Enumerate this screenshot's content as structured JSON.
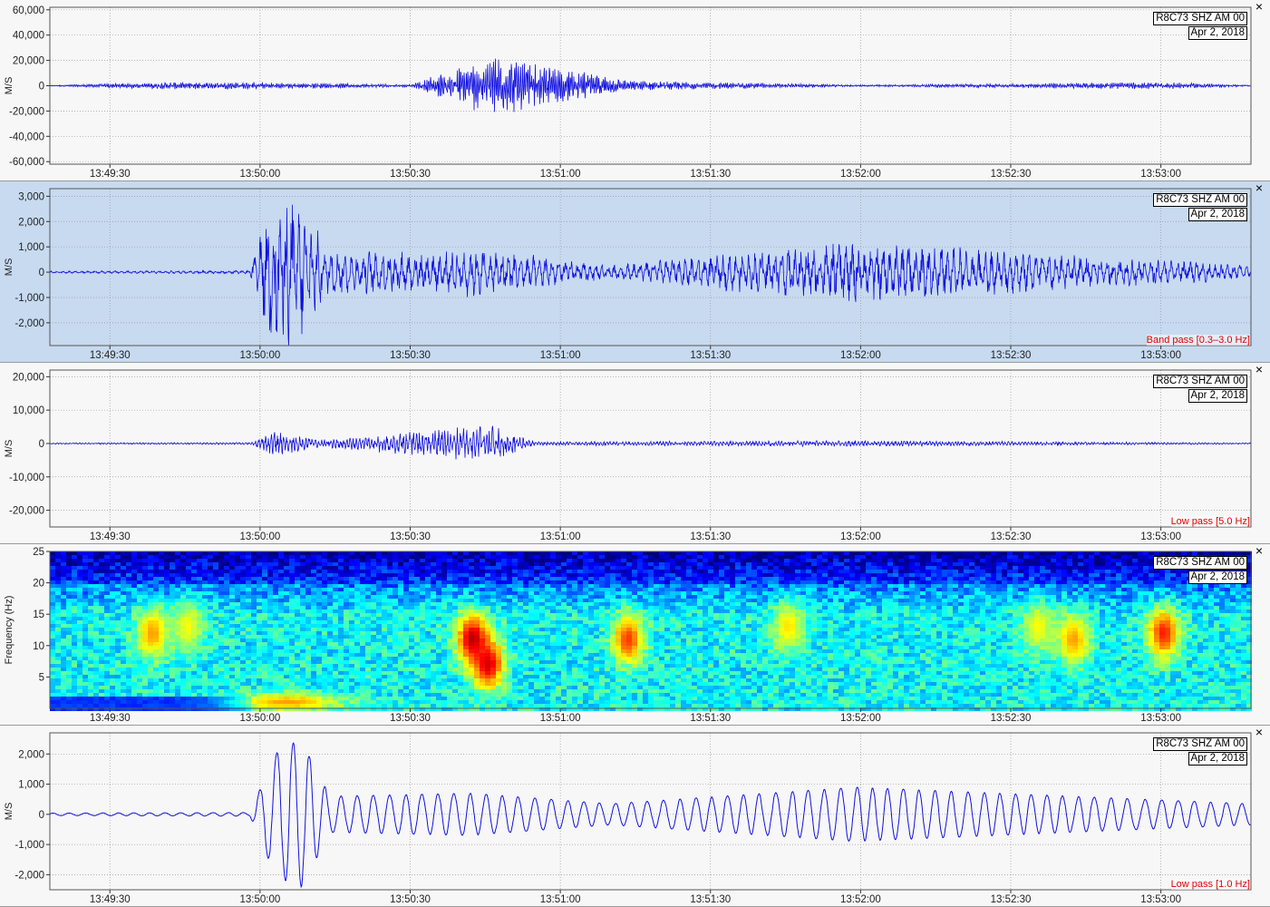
{
  "station_label": "R8C73 SHZ AM 00",
  "date_label": "Apr 2, 2018",
  "close_glyph": "×",
  "time_ticks": [
    "13:49:30",
    "13:50:00",
    "13:50:30",
    "13:51:00",
    "13:51:30",
    "13:52:00",
    "13:52:30",
    "13:53:00"
  ],
  "waveform_color": "#1010e0",
  "filter_color": "#e00000",
  "panels": [
    {
      "ylabel": "M/S",
      "selected": false,
      "filter": "",
      "chart_data": {
        "type": "line",
        "title": "",
        "xlabel": "",
        "ylabel": "M/S",
        "ylim": [
          -62000,
          62000
        ],
        "yticks": [
          60000,
          40000,
          20000,
          0,
          -20000,
          -40000,
          -60000
        ],
        "ytick_labels": [
          "60,000",
          "40,000",
          "20,000",
          "0",
          "-20,000",
          "-40,000",
          "-60,000"
        ],
        "series": [
          {
            "values": [
              {
                "t": "13:49:18",
                "amp": 400
              },
              {
                "t": "13:49:40",
                "amp": 2500
              },
              {
                "t": "13:50:00",
                "amp": 2500
              },
              {
                "t": "13:50:30",
                "amp": 900
              },
              {
                "t": "13:50:42",
                "amp": 17000
              },
              {
                "t": "13:50:47",
                "amp": 21000
              },
              {
                "t": "13:51:14",
                "amp": 3500
              },
              {
                "t": "13:52:00",
                "amp": 600
              },
              {
                "t": "13:53:00",
                "amp": 2500
              },
              {
                "t": "13:53:18",
                "amp": 400
              }
            ]
          }
        ]
      }
    },
    {
      "ylabel": "M/S",
      "selected": true,
      "filter": "Band pass [0.3–3.0 Hz]",
      "chart_data": {
        "type": "line",
        "title": "",
        "xlabel": "",
        "ylabel": "M/S",
        "ylim": [
          -2900,
          3300
        ],
        "yticks": [
          3000,
          2000,
          1000,
          0,
          -1000,
          -2000
        ],
        "ytick_labels": [
          "3,000",
          "2,000",
          "1,000",
          "0",
          "-1,000",
          "-2,000"
        ],
        "series": [
          {
            "values": [
              {
                "t": "13:49:18",
                "amp": 40
              },
              {
                "t": "13:49:58",
                "amp": 60
              },
              {
                "t": "13:50:02",
                "amp": 2600
              },
              {
                "t": "13:50:06",
                "amp": 2900
              },
              {
                "t": "13:50:14",
                "amp": 800
              },
              {
                "t": "13:50:35",
                "amp": 700
              },
              {
                "t": "13:50:42",
                "amp": 900
              },
              {
                "t": "13:51:10",
                "amp": 250
              },
              {
                "t": "13:51:59",
                "amp": 1100
              },
              {
                "t": "13:53:18",
                "amp": 250
              }
            ]
          }
        ]
      }
    },
    {
      "ylabel": "M/S",
      "selected": false,
      "filter": "Low pass [5.0 Hz]",
      "chart_data": {
        "type": "line",
        "title": "",
        "xlabel": "",
        "ylabel": "M/S",
        "ylim": [
          -25000,
          22000
        ],
        "yticks": [
          20000,
          10000,
          0,
          -10000,
          -20000
        ],
        "ytick_labels": [
          "20,000",
          "10,000",
          "0",
          "-10,000",
          "-20,000"
        ],
        "series": [
          {
            "values": [
              {
                "t": "13:49:18",
                "amp": 200
              },
              {
                "t": "13:49:58",
                "amp": 300
              },
              {
                "t": "13:50:03",
                "amp": 3500
              },
              {
                "t": "13:50:12",
                "amp": 1000
              },
              {
                "t": "13:50:42",
                "amp": 4500
              },
              {
                "t": "13:50:47",
                "amp": 5000
              },
              {
                "t": "13:50:55",
                "amp": 500
              },
              {
                "t": "13:52:00",
                "amp": 800
              },
              {
                "t": "13:53:18",
                "amp": 200
              }
            ]
          }
        ]
      }
    },
    {
      "ylabel": "Frequency (Hz)",
      "selected": false,
      "filter": "",
      "chart_data": {
        "type": "heatmap",
        "title": "",
        "xlabel": "",
        "ylabel": "Frequency (Hz)",
        "ylim": [
          0,
          25
        ],
        "yticks": [
          25,
          20,
          15,
          10,
          5
        ],
        "ytick_labels": [
          "25",
          "20",
          "15",
          "10",
          "5"
        ],
        "hot_spots": [
          {
            "t": "13:49:38",
            "f": 12,
            "level": 0.72
          },
          {
            "t": "13:49:45",
            "f": 13,
            "level": 0.62
          },
          {
            "t": "13:50:42",
            "f": 11,
            "level": 0.95
          },
          {
            "t": "13:50:45",
            "f": 7,
            "level": 0.92
          },
          {
            "t": "13:51:13",
            "f": 11,
            "level": 0.82
          },
          {
            "t": "13:51:45",
            "f": 13,
            "level": 0.65
          },
          {
            "t": "13:52:35",
            "f": 13,
            "level": 0.62
          },
          {
            "t": "13:52:42",
            "f": 11,
            "level": 0.72
          },
          {
            "t": "13:53:00",
            "f": 12,
            "level": 0.85
          },
          {
            "t": "13:50:05",
            "f": 1,
            "level": 0.72
          }
        ]
      }
    },
    {
      "ylabel": "M/S",
      "selected": false,
      "filter": "Low pass [1.0 Hz]",
      "chart_data": {
        "type": "line",
        "title": "",
        "xlabel": "",
        "ylabel": "M/S",
        "ylim": [
          -2500,
          2700
        ],
        "yticks": [
          2000,
          1000,
          0,
          -1000,
          -2000
        ],
        "ytick_labels": [
          "2,000",
          "1,000",
          "0",
          "-1,000",
          "-2,000"
        ],
        "series": [
          {
            "values": [
              {
                "t": "13:49:18",
                "amp": 40
              },
              {
                "t": "13:49:58",
                "amp": 60
              },
              {
                "t": "13:50:03",
                "amp": 2000
              },
              {
                "t": "13:50:08",
                "amp": 2500
              },
              {
                "t": "13:50:14",
                "amp": 600
              },
              {
                "t": "13:50:42",
                "amp": 700
              },
              {
                "t": "13:51:10",
                "amp": 350
              },
              {
                "t": "13:51:59",
                "amp": 900
              },
              {
                "t": "13:53:18",
                "amp": 350
              }
            ]
          }
        ]
      }
    }
  ]
}
